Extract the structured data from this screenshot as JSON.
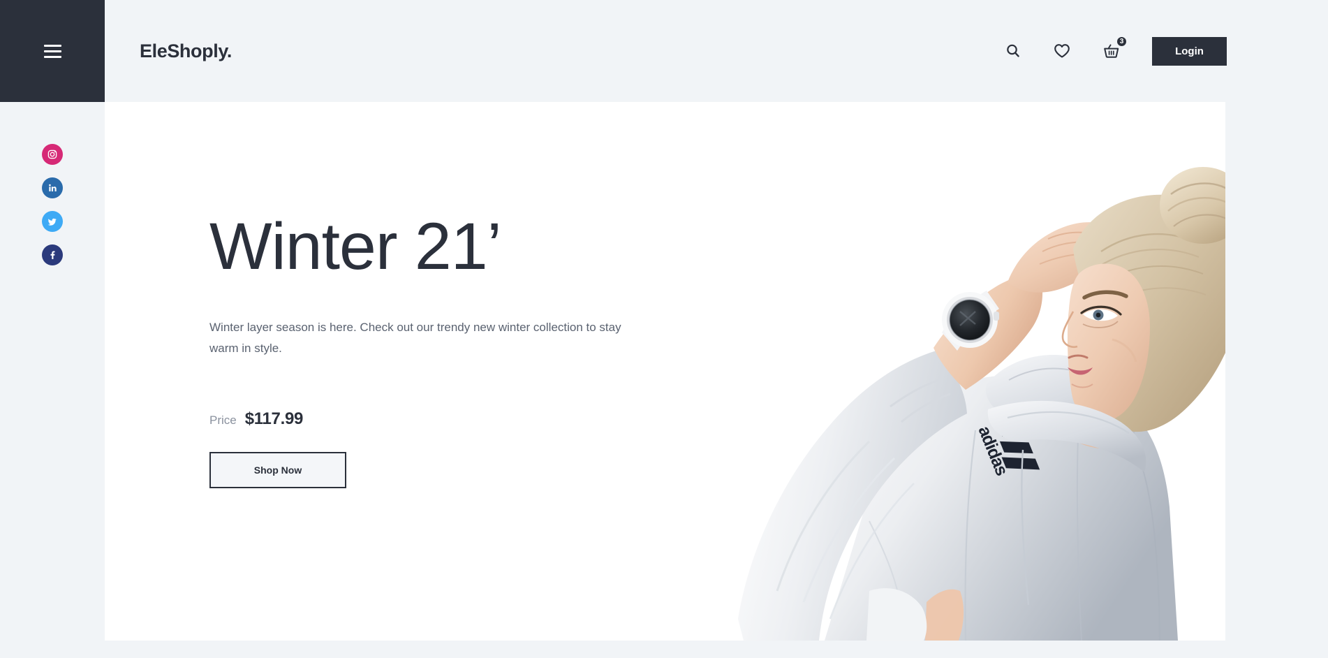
{
  "brand": {
    "name": "EleShoply."
  },
  "menu": {
    "icon": "hamburger-menu-icon"
  },
  "header": {
    "search_icon": "search-icon",
    "wishlist_icon": "heart-icon",
    "cart_icon": "basket-icon",
    "cart_count": "3",
    "login_label": "Login"
  },
  "social": {
    "items": [
      {
        "name": "instagram",
        "label": "Instagram",
        "color": "#d62976"
      },
      {
        "name": "linkedin",
        "label": "LinkedIn",
        "color": "#2a6bab"
      },
      {
        "name": "twitter",
        "label": "Twitter",
        "color": "#3eaaf5"
      },
      {
        "name": "facebook",
        "label": "Facebook",
        "color": "#2b3a7c"
      }
    ]
  },
  "hero": {
    "title": "Winter 21’",
    "description": "Winter layer season is here. Check out our trendy new winter collection to stay warm in style.",
    "price_label": "Price",
    "price_value": "$117.99",
    "cta_label": "Shop Now",
    "image_alt": "woman-in-white-hoodie-photo",
    "brand_on_garment": "adidas"
  },
  "colors": {
    "page_bg": "#f1f4f7",
    "card_bg": "#ffffff",
    "dark": "#2b303b",
    "muted_text": "#5a6270"
  }
}
